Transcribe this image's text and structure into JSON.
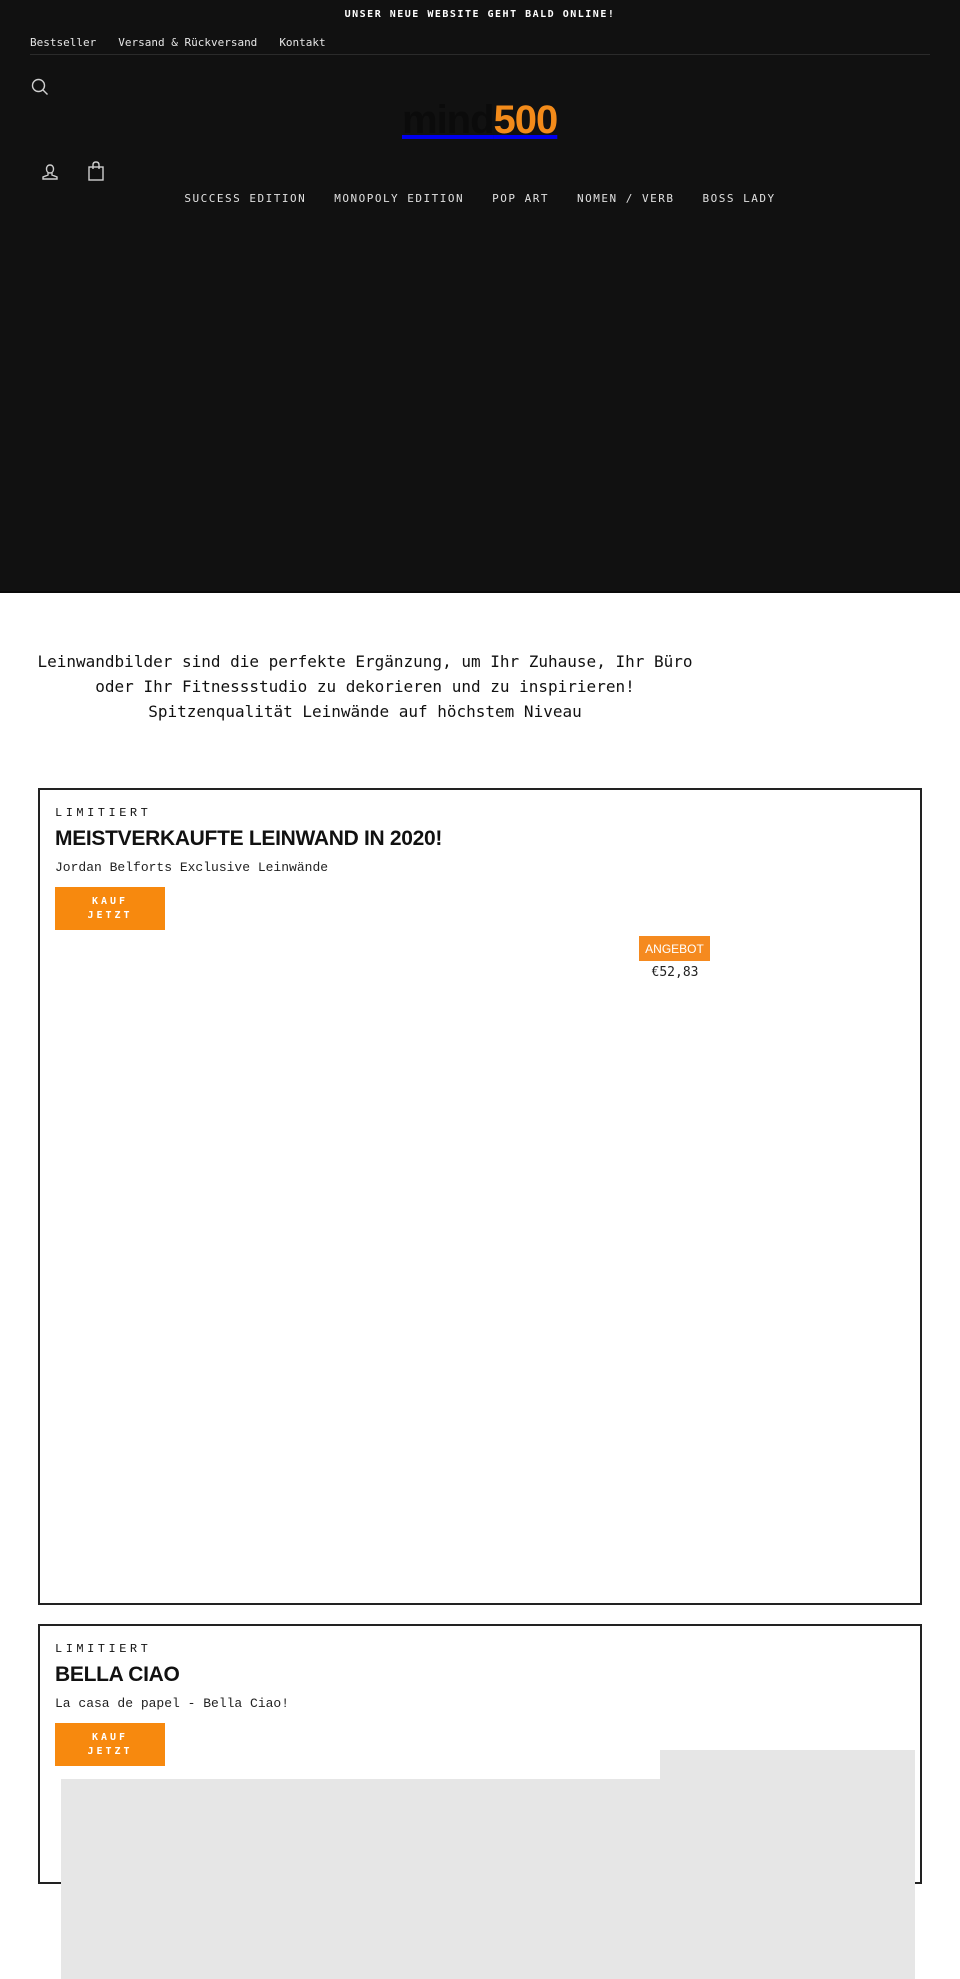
{
  "announcement": "UNSER NEUE WEBSITE GEHT BALD ONLINE!",
  "utility_nav": [
    {
      "label": "Bestseller"
    },
    {
      "label": "Versand & Rückversand"
    },
    {
      "label": "Kontakt"
    }
  ],
  "header_icons": {
    "search": "search-icon",
    "account": "user-icon",
    "cart": "shopping-bag-icon"
  },
  "logo": {
    "part1": "mind",
    "part2": "500"
  },
  "main_nav": [
    {
      "label": "SUCCESS EDITION"
    },
    {
      "label": "MONOPOLY EDITION"
    },
    {
      "label": "POP ART"
    },
    {
      "label": "NOMEN / VERB"
    },
    {
      "label": "BOSS LADY"
    }
  ],
  "intro": {
    "line1": "Leinwandbilder sind die perfekte Ergänzung, um Ihr Zuhause, Ihr Büro",
    "line2": "oder Ihr Fitnessstudio zu dekorieren und zu inspirieren!",
    "line3": "Spitzenqualität Leinwände auf höchstem Niveau"
  },
  "colors": {
    "accent": "#f7890e",
    "header_bg": "#111111"
  },
  "cards": [
    {
      "eyebrow": "LIMITIERT",
      "title": "MEISTVERKAUFTE LEINWAND IN 2020!",
      "subtitle": "Jordan Belforts Exclusive Leinwände",
      "button_line1": "KAUF",
      "button_line2": "JETZT",
      "badge": "ANGEBOT",
      "price": "€52,83"
    },
    {
      "eyebrow": "LIMITIERT",
      "title": "BELLA CIAO",
      "subtitle": "La casa de papel - Bella Ciao!",
      "button_line1": "KAUF",
      "button_line2": "JETZT"
    }
  ]
}
